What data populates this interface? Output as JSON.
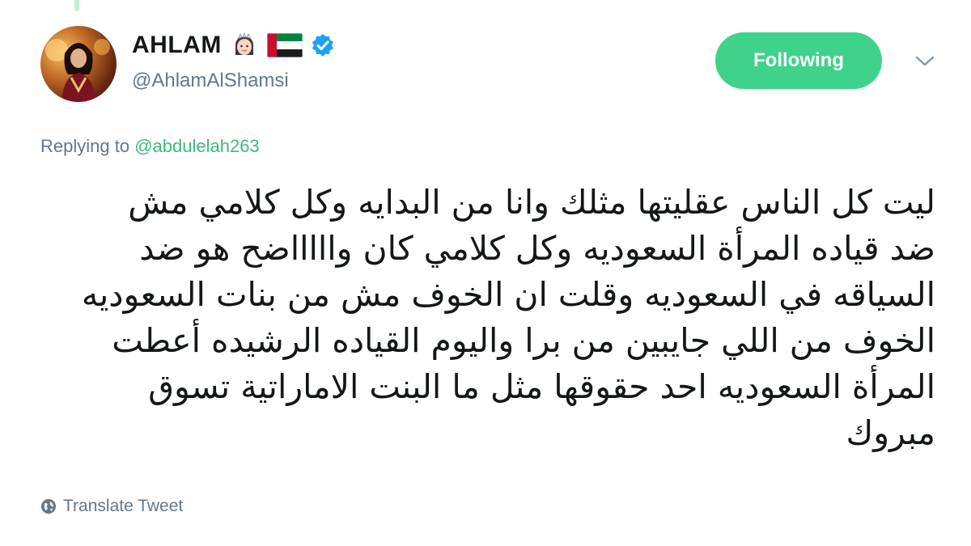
{
  "user": {
    "display_name": "AHLAM",
    "handle": "@AhlamAlShamsi",
    "badges": [
      "princess-emoji-icon",
      "uae-flag-icon",
      "verified-badge-icon"
    ]
  },
  "actions": {
    "follow_label": "Following",
    "menu_icon": "chevron-down-icon"
  },
  "reply": {
    "prefix": "Replying to",
    "mention": "@abdulelah263"
  },
  "tweet": {
    "lines": [
      "ليت كل الناس عقليتها مثلك وانا من البدايه وكل كلامي مش",
      "ضد قياده المرأة السعوديه وكل كلامي كان واااااضح هو ضد",
      "السياقه في السعوديه وقلت ان الخوف مش من بنات السعوديه",
      "الخوف من اللي جايبين من برا واليوم القياده الرشيده أعطت",
      "المرأة السعوديه احد حقوقها مثل ما البنت الاماراتية تسوق",
      "مبروك"
    ]
  },
  "footer": {
    "translate_label": "Translate Tweet",
    "translate_icon": "globe-icon"
  },
  "colors": {
    "accent_green": "#3fd28b",
    "mention_green": "#3fb97c",
    "verified_blue": "#1da1f2",
    "text": "#14171a",
    "muted": "#657786"
  }
}
